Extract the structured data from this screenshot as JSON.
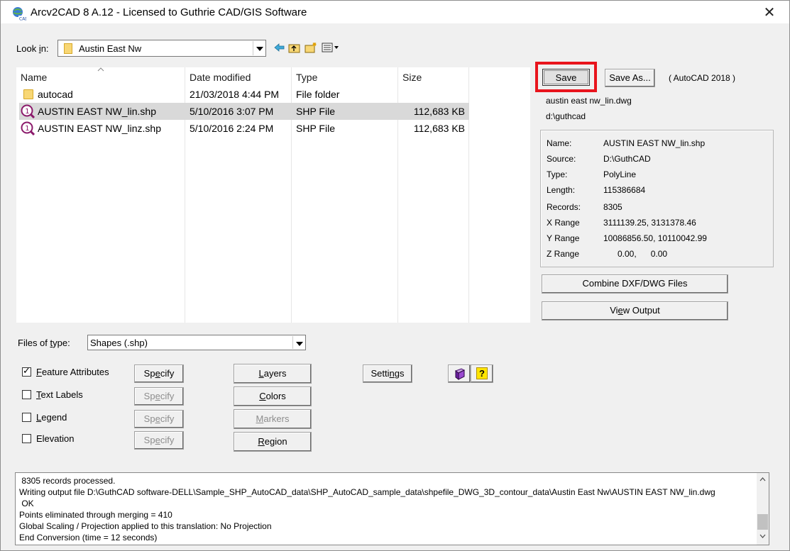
{
  "window": {
    "title": "Arcv2CAD 8 A.12 - Licensed to Guthrie CAD/GIS Software",
    "close_glyph": "✕"
  },
  "look_in": {
    "label_pre": "Look ",
    "label_u": "i",
    "label_post": "n:",
    "value": "Austin East Nw"
  },
  "toolbar_icons": [
    "back-arrow-icon",
    "up-folder-icon",
    "new-folder-icon",
    "view-menu-icon"
  ],
  "file_list": {
    "columns": [
      "Name",
      "Date modified",
      "Type",
      "Size"
    ],
    "rows": [
      {
        "name": "autocad",
        "date": "21/03/2018 4:44 PM",
        "type": "File folder",
        "size": "",
        "icon": "folder-icon"
      },
      {
        "name": "AUSTIN EAST NW_lin.shp",
        "date": "5/10/2016 3:07 PM",
        "type": "SHP File",
        "size": "112,683 KB",
        "icon": "shp-file-icon",
        "selected": true
      },
      {
        "name": "AUSTIN EAST NW_linz.shp",
        "date": "5/10/2016 2:24 PM",
        "type": "SHP File",
        "size": "112,683 KB",
        "icon": "shp-file-icon"
      }
    ]
  },
  "right_panel": {
    "save_label": "Save",
    "save_as_label": "Save As...",
    "format_label": "( AutoCAD 2018 )",
    "output_file": "austin east nw_lin.dwg",
    "output_dir": "d:\\guthcad",
    "info": [
      {
        "k": "Name:",
        "v": "AUSTIN EAST NW_lin.shp"
      },
      {
        "k": "Source:",
        "v": "D:\\GuthCAD"
      },
      {
        "k": "Type:",
        "v": "PolyLine"
      },
      {
        "k": "Length:",
        "v": "115386684"
      },
      {
        "k": "Records:",
        "v": "8305"
      },
      {
        "k": "X Range",
        "v": "3111139.25, 3131378.46"
      },
      {
        "k": "Y Range",
        "v": "10086856.50, 10110042.99"
      },
      {
        "k": "Z Range",
        "v": "      0.00,      0.00"
      }
    ],
    "combine_label": "Combine DXF/DWG Files",
    "view_output_pre": "Vi",
    "view_output_u": "e",
    "view_output_post": "w Output"
  },
  "files_of_type": {
    "label_pre": "Files of ",
    "label_u": "t",
    "label_post": "ype:",
    "value": "Shapes (.shp)"
  },
  "options": [
    {
      "u": "F",
      "rest": "eature Attributes",
      "checked": true,
      "specify_enabled": true
    },
    {
      "u": "T",
      "rest": "ext Labels",
      "checked": false,
      "specify_enabled": false
    },
    {
      "u": "L",
      "rest": "egend",
      "checked": false,
      "specify_enabled": false
    },
    {
      "u": "E",
      "rest": "levation",
      "checked": false,
      "specify_enabled": false,
      "pre": "E",
      "mid_u": "l"
    }
  ],
  "specify": {
    "pre": "Sp",
    "u": "e",
    "post": "cify"
  },
  "buttons": {
    "layers": {
      "u": "L",
      "rest": "ayers"
    },
    "colors": {
      "u": "C",
      "rest": "olors"
    },
    "markers": {
      "u": "M",
      "rest": "arkers"
    },
    "region": {
      "u": "R",
      "rest": "egion"
    },
    "settings": {
      "pre": "Setti",
      "u": "n",
      "post": "gs"
    },
    "help_glyph": "?"
  },
  "log": [
    " 8305 records processed.",
    "Writing output file D:\\GuthCAD software-DELL\\Sample_SHP_AutoCAD_data\\SHP_AutoCAD_sample_data\\shpefile_DWG_3D_contour_data\\Austin East Nw\\AUSTIN EAST NW_lin.dwg",
    " OK",
    "Points eliminated through merging = 410",
    "Global Scaling / Projection applied to this translation: No Projection",
    "End Conversion (time = 12 seconds)"
  ],
  "colors": {
    "highlight": "#e8141c",
    "selection": "#d9d9d9"
  }
}
